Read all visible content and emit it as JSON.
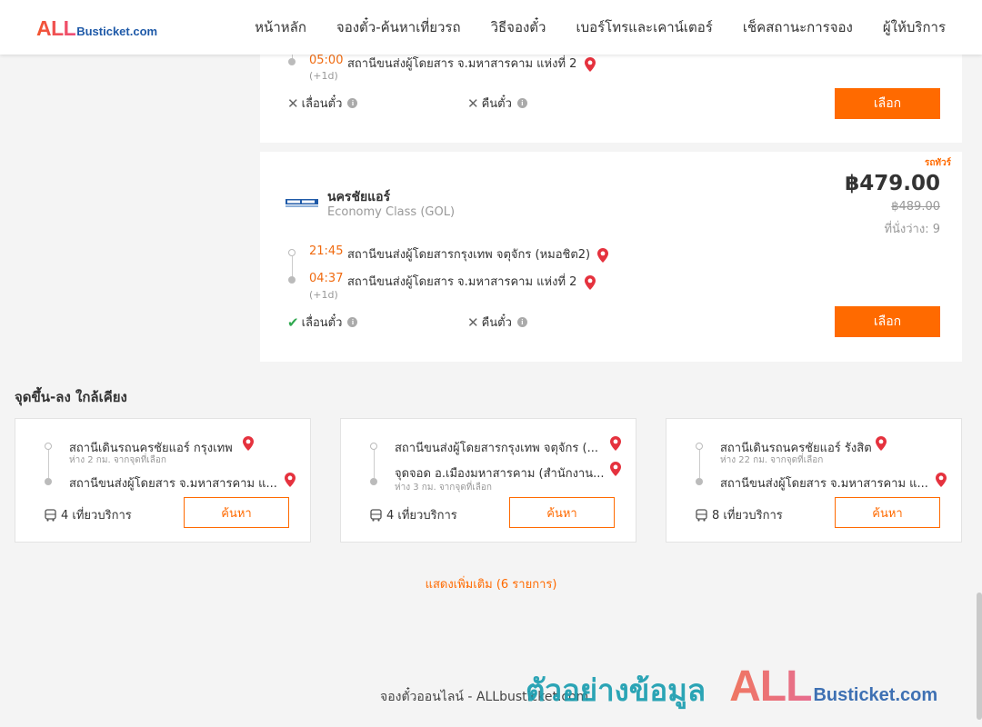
{
  "header": {
    "logo_all": "ALL",
    "logo_rest": "Busticket.com",
    "nav": [
      "หน้าหลัก",
      "จองตั๋ว-ค้นหาเที่ยวรถ",
      "วิธีจองตั๋ว",
      "เบอร์โทรและเคาน์เตอร์",
      "เช็คสถานะการจอง",
      "ผู้ให้บริการ"
    ]
  },
  "trip1": {
    "arrive_time": "05:00",
    "arrive_stop": "สถานีขนส่งผู้โดยสาร จ.มหาสารคาม แห่งที่ 2",
    "arrive_plus": "(+1d)",
    "reschedule_label": "เลื่อนตั๋ว",
    "refund_label": "คืนตั๋ว",
    "select_label": "เลือก"
  },
  "trip2": {
    "badge": "รถทัวร์",
    "operator": "นครชัยแอร์",
    "bus_class": "Economy Class (GOL)",
    "price": "฿479.00",
    "old_price": "฿489.00",
    "seats": "ที่นั่งว่าง: 9",
    "depart_time": "21:45",
    "depart_stop": "สถานีขนส่งผู้โดยสารกรุงเทพ จตุจักร (หมอชิต2)",
    "arrive_time": "04:37",
    "arrive_stop": "สถานีขนส่งผู้โดยสาร จ.มหาสารคาม แห่งที่ 2",
    "arrive_plus": "(+1d)",
    "reschedule_label": "เลื่อนตั๋ว",
    "refund_label": "คืนตั๋ว",
    "select_label": "เลือก"
  },
  "nearby": {
    "title": "จุดขึ้น-ลง ใกล้เคียง",
    "cards": [
      {
        "from": "สถานีเดินรถนครชัยแอร์ กรุงเทพ",
        "from_dist": "ห่าง 2 กม. จากจุดที่เลือก",
        "to": "สถานีขนส่งผู้โดยสาร จ.มหาสารคาม แ...",
        "to_dist": "",
        "trips": "4 เที่ยวบริการ",
        "search_label": "ค้นหา"
      },
      {
        "from": "สถานีขนส่งผู้โดยสารกรุงเทพ จตุจักร (...",
        "from_dist": "",
        "to": "จุดจอด อ.เมืองมหาสารคาม (สำนักงาน...",
        "to_dist": "ห่าง 3 กม. จากจุดที่เลือก",
        "trips": "4 เที่ยวบริการ",
        "search_label": "ค้นหา"
      },
      {
        "from": "สถานีเดินรถนครชัยแอร์ รังสิต",
        "from_dist": "ห่าง 22 กม. จากจุดที่เลือก",
        "to": "สถานีขนส่งผู้โดยสาร จ.มหาสารคาม แ...",
        "to_dist": "",
        "trips": "8 เที่ยวบริการ",
        "search_label": "ค้นหา"
      }
    ],
    "show_more": "แสดงเพิ่มเติม (6 รายการ)"
  },
  "footer": {
    "text": "จองตั๋วออนไลน์ - ALLbusticket.com"
  },
  "watermark": {
    "thai": "ตัวอย่างข้อมูล",
    "all": "ALL",
    "rest": "Busticket.com"
  },
  "colors": {
    "accent": "#ff6a00",
    "time": "#f06a0f",
    "pin": "#e5323e",
    "check": "#2fa84f",
    "brand_blue": "#1f5aa8"
  }
}
